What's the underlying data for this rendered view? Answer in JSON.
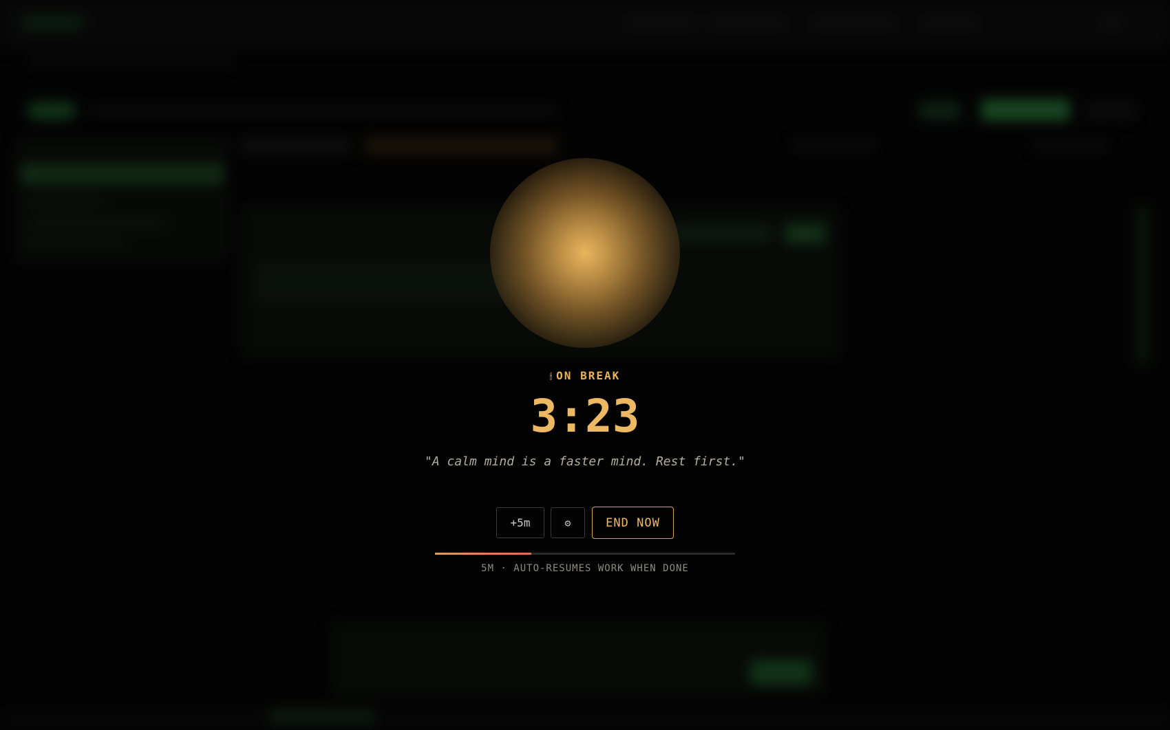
{
  "break_overlay": {
    "status_icon": "flame-icon",
    "status_label": "ON BREAK",
    "timer": "3:23",
    "quote": "\"A calm mind is a faster mind. Rest first.\"",
    "buttons": {
      "extend_label": "+5m",
      "settings_icon": "gear-icon",
      "settings_glyph": "⚙",
      "end_label": "END NOW"
    },
    "progress_fraction": 0.32,
    "caption": "5M · AUTO-RESUMES WORK WHEN DONE"
  },
  "colors": {
    "accent": "#edb862",
    "progress_start": "#e49a52",
    "progress_end": "#e06a56",
    "background": "#030303"
  }
}
